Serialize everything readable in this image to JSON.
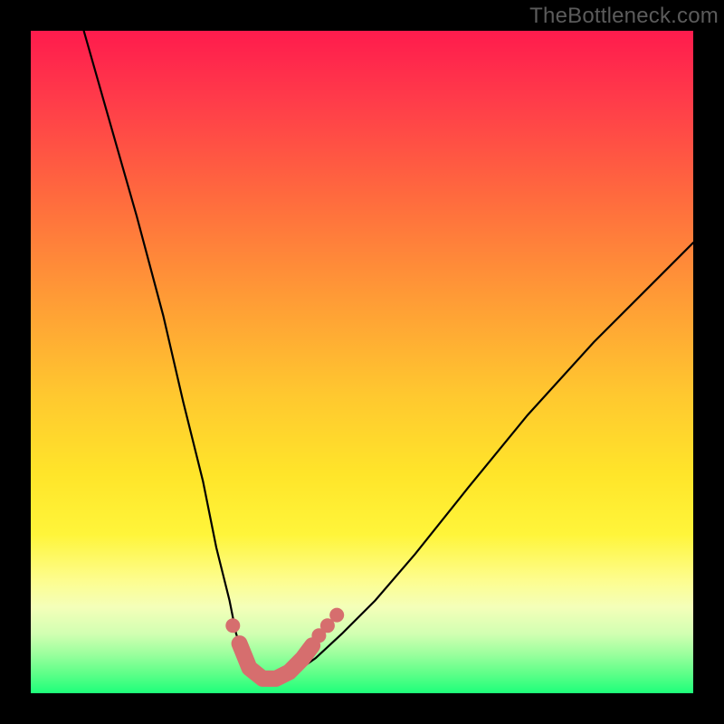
{
  "watermark": "TheBottleneck.com",
  "colors": {
    "page_bg": "#000000",
    "gradient_top": "#ff1b4d",
    "gradient_bottom": "#1dff7a",
    "curve": "#000000",
    "marker": "#d66e6e"
  },
  "chart_data": {
    "type": "line",
    "title": "",
    "xlabel": "",
    "ylabel": "",
    "xlim": [
      0,
      100
    ],
    "ylim": [
      0,
      100
    ],
    "grid": false,
    "legend": false,
    "series": [
      {
        "name": "left-curve",
        "x": [
          8,
          12,
          16,
          20,
          23,
          26,
          28,
          30,
          31,
          32,
          33,
          34,
          35,
          36
        ],
        "values": [
          100,
          86,
          72,
          57,
          44,
          32,
          22,
          14,
          9,
          6,
          4,
          2.8,
          2,
          1.6
        ]
      },
      {
        "name": "right-curve",
        "x": [
          36,
          38,
          40,
          43,
          47,
          52,
          58,
          66,
          75,
          85,
          95,
          100
        ],
        "values": [
          1.6,
          2.2,
          3.2,
          5.3,
          9,
          14,
          21,
          31,
          42,
          53,
          63,
          68
        ]
      },
      {
        "name": "marker-curve",
        "x": [
          31.5,
          33,
          35,
          37,
          39,
          41,
          42.5
        ],
        "values": [
          7.5,
          3.8,
          2.2,
          2.2,
          3.2,
          5.2,
          7.2
        ]
      },
      {
        "name": "extra-dots",
        "x": [
          30.5,
          43.5,
          44.8,
          46.2
        ],
        "values": [
          10.2,
          8.7,
          10.2,
          11.8
        ]
      }
    ]
  }
}
